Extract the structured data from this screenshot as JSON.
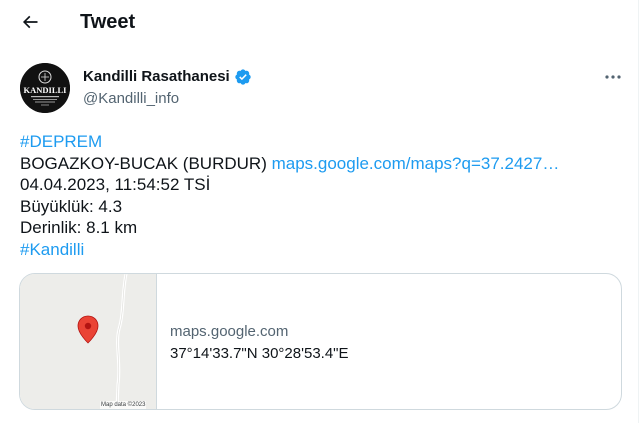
{
  "header": {
    "back_icon": "arrow-left-icon",
    "title": "Tweet"
  },
  "tweet": {
    "author": {
      "name": "Kandilli Rasathanesi",
      "handle": "@Kandilli_info",
      "verified_icon": "verified-badge-icon",
      "avatar_text": "KANDILLI"
    },
    "more_icon": "more-dots-icon",
    "body": {
      "hashtag_depremi": "#DEPREM",
      "location_text": "BOGAZKOY-BUCAK (BURDUR) ",
      "map_link": "maps.google.com/maps?q=37.2427…",
      "datetime": "04.04.2023, 11:54:52 TSİ",
      "magnitude": "Büyüklük: 4.3",
      "depth": "Derinlik: 8.1 km",
      "hashtag_kandilli": "#Kandilli"
    },
    "card": {
      "domain": "maps.google.com",
      "title": "37°14'33.7\"N 30°28'53.4\"E",
      "map_credit": "Map data ©2023"
    }
  },
  "colors": {
    "link": "#1d9bf0",
    "verified": "#1d9bf0",
    "muted": "#536471",
    "border": "#cfd9de",
    "map_pin": "#ea4335"
  }
}
